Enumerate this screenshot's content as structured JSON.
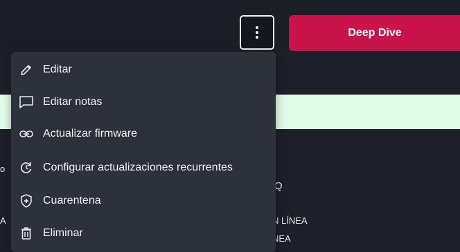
{
  "header": {
    "more_icon": "vertical-ellipsis-icon",
    "primary_button_label": "Deep Dive",
    "primary_color": "#c8144a"
  },
  "menu": {
    "items": [
      {
        "label": "Editar",
        "icon": "pencil-icon"
      },
      {
        "label": "Editar notas",
        "icon": "chat-bubble-icon"
      },
      {
        "label": "Actualizar firmware",
        "icon": "link-icon"
      },
      {
        "label": "Configurar actualizaciones recurrentes",
        "icon": "recurring-refresh-icon"
      },
      {
        "label": "Cuarentena",
        "icon": "shield-plus-icon"
      },
      {
        "label": "Eliminar",
        "icon": "trash-icon"
      }
    ]
  },
  "background": {
    "fragment_q": "Q",
    "status_1": "N LÍNEA",
    "status_2": "NEA"
  }
}
